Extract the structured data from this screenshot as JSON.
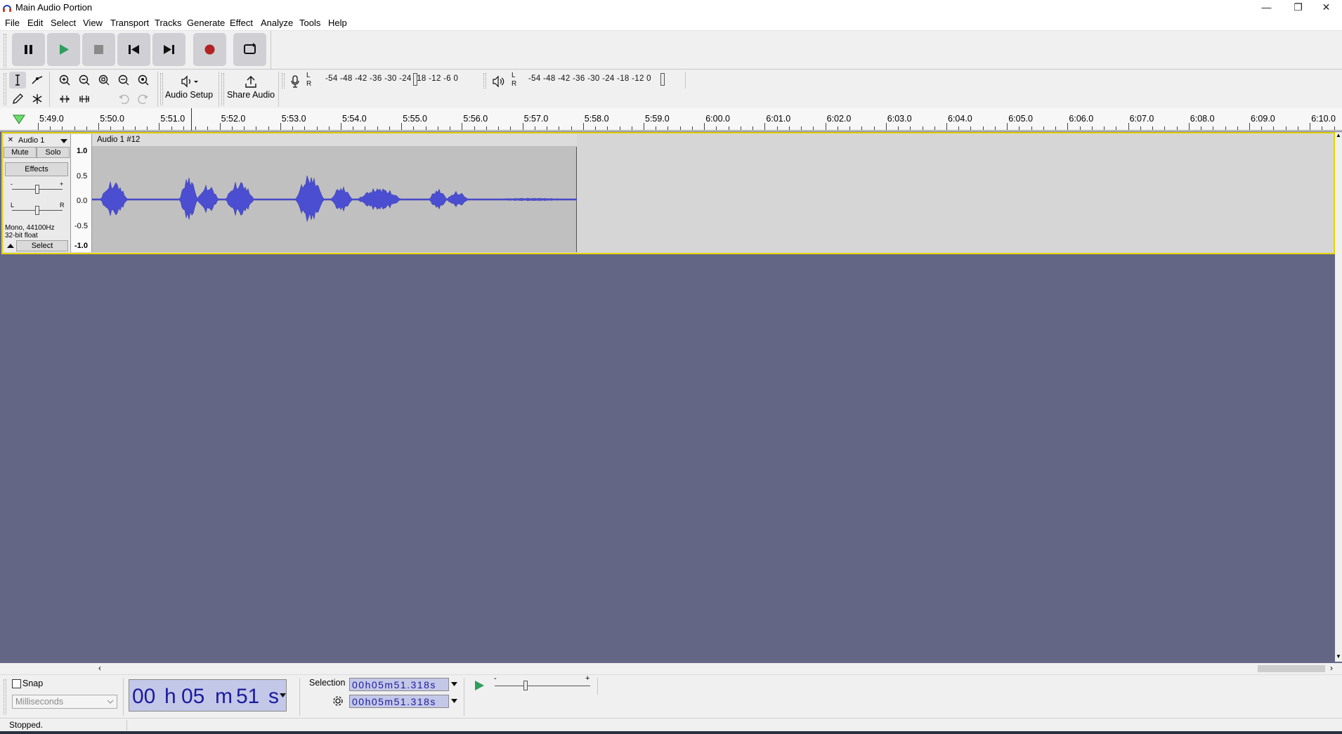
{
  "window": {
    "title": "Main Audio Portion",
    "controls": [
      "—",
      "❐",
      "✕"
    ]
  },
  "menu": [
    "File",
    "Edit",
    "Select",
    "View",
    "Transport",
    "Tracks",
    "Generate",
    "Effect",
    "Analyze",
    "Tools",
    "Help"
  ],
  "toolbar": {
    "audio_setup_label": "Audio Setup",
    "share_audio_label": "Share Audio",
    "record_meter_labels": "-54 -48 -42 -36 -30 -24 -18 -12 -6 0",
    "record_meter_channels": [
      "L",
      "R"
    ],
    "play_meter_labels": "-54 -48 -42 -36 -30 -24 -18 -12 0",
    "play_meter_channels": [
      "L",
      "R"
    ],
    "record_color": "#b22222",
    "play_color": "#2e9e5c"
  },
  "ruler": {
    "labels": [
      "5:49.0",
      "5:50.0",
      "5:51.0",
      "5:52.0",
      "5:53.0",
      "5:54.0",
      "5:55.0",
      "5:56.0",
      "5:57.0",
      "5:58.0",
      "5:59.0",
      "6:00.0",
      "6:01.0",
      "6:02.0",
      "6:03.0",
      "6:04.0",
      "6:05.0",
      "6:06.0",
      "6:07.0",
      "6:08.0",
      "6:09.0",
      "6:10.0"
    ]
  },
  "track": {
    "close_glyph": "✕",
    "name": "Audio 1",
    "mute_label": "Mute",
    "solo_label": "Solo",
    "effects_label": "Effects",
    "gain_minus": "-",
    "gain_plus": "+",
    "pan_left": "L",
    "pan_right": "R",
    "info_line1": "Mono, 44100Hz",
    "info_line2": "32-bit float",
    "select_label": "Select",
    "clip_name": "Audio 1 #12",
    "vruler_labels": [
      "1.0",
      "0.5",
      "0.0",
      "-0.5",
      "-1.0"
    ],
    "wave_color": "#4b4ed0",
    "selection_color": "#e6d400"
  },
  "bottom": {
    "snap_label": "Snap",
    "snap_checked": false,
    "snap_format": "Milliseconds",
    "time_digits": {
      "h": "00",
      "m": "05",
      "s": "51",
      "hu": "h",
      "mu": "m",
      "su": "s"
    },
    "selection_label": "Selection",
    "selection_start": "00h05m51.318s",
    "selection_end": "00h05m51.318s",
    "speed_minus": "-",
    "speed_plus": "+"
  },
  "status": {
    "text": "Stopped."
  }
}
